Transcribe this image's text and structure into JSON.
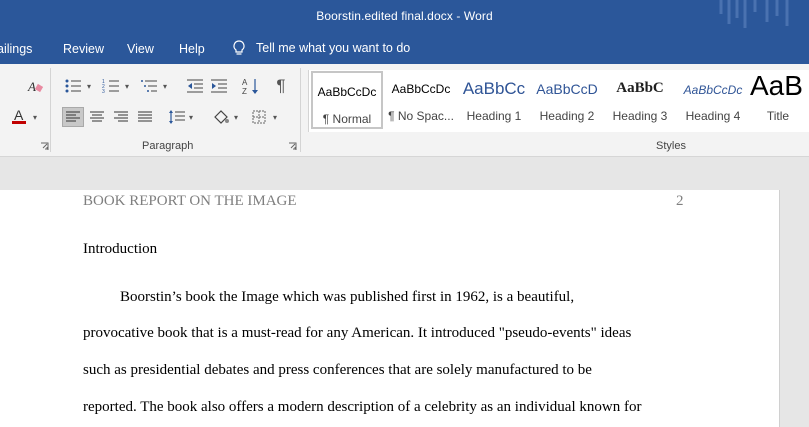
{
  "window": {
    "title": "Boorstin.edited final.docx  -  Word"
  },
  "tabs": {
    "mailings": "ailings",
    "review": "Review",
    "view": "View",
    "help": "Help",
    "tell_me": "Tell me what you want to do"
  },
  "ribbon": {
    "paragraph_label": "Paragraph",
    "styles_label": "Styles",
    "styles": [
      {
        "sample": "AaBbCcDc",
        "name": "¶ Normal"
      },
      {
        "sample": "AaBbCcDc",
        "name": "¶ No Spac..."
      },
      {
        "sample": "AaBbCc",
        "name": "Heading 1"
      },
      {
        "sample": "AaBbCcD",
        "name": "Heading 2"
      },
      {
        "sample": "AaBbC",
        "name": "Heading 3"
      },
      {
        "sample": "AaBbCcDc",
        "name": "Heading 4"
      },
      {
        "sample": "AaB",
        "name": "Title"
      }
    ],
    "colors": {
      "font_color": "#c00000",
      "accent": "#2b579a",
      "heading_blue": "#2f5496"
    },
    "icons": [
      "eraser-icon",
      "bullets-icon",
      "numbering-icon",
      "multilevel-list-icon",
      "decrease-indent-icon",
      "increase-indent-icon",
      "sort-icon",
      "pilcrow-icon",
      "font-color-icon",
      "align-left-icon",
      "align-center-icon",
      "align-right-icon",
      "justify-icon",
      "line-spacing-icon",
      "shading-icon",
      "borders-icon",
      "lightbulb-icon"
    ]
  },
  "document": {
    "header": "BOOK REPORT ON THE IMAGE",
    "page_number": "2",
    "heading": "Introduction",
    "lines": [
      "Boorstin’s book the Image which was published first in 1962, is a beautiful,",
      "provocative book that is a must-read for any American. It introduced \"pseudo-events\" ideas",
      "such as presidential debates and press conferences that are solely manufactured to be",
      "reported. The book also offers a modern description of a celebrity as an individual known for"
    ]
  }
}
